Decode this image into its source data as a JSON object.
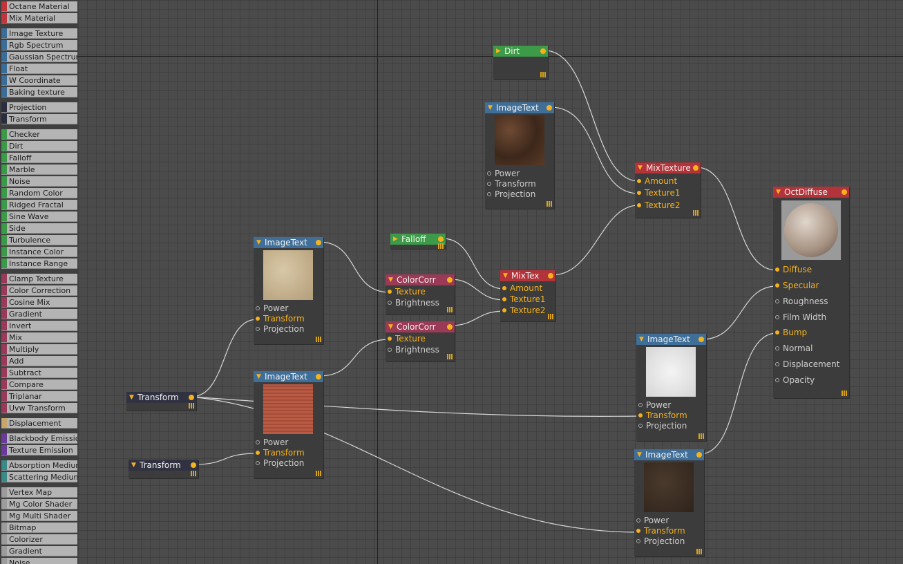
{
  "sidebar": {
    "items": [
      {
        "label": "Octane Material",
        "color": "#c0353c"
      },
      {
        "label": "Mix Material",
        "color": "#c0353c"
      },
      {
        "label": "Image Texture",
        "color": "#3b6d9b"
      },
      {
        "label": "Rgb Spectrum",
        "color": "#3b6d9b"
      },
      {
        "label": "Gaussian Spectrum",
        "color": "#3b6d9b"
      },
      {
        "label": "Float",
        "color": "#3b6d9b"
      },
      {
        "label": "W Coordinate",
        "color": "#3b6d9b"
      },
      {
        "label": "Baking texture",
        "color": "#3b6d9b"
      },
      {
        "label": "Projection",
        "color": "#2a2d3e"
      },
      {
        "label": "Transform",
        "color": "#2a2d3e"
      },
      {
        "label": "Checker",
        "color": "#3a9a48"
      },
      {
        "label": "Dirt",
        "color": "#3a9a48"
      },
      {
        "label": "Falloff",
        "color": "#3a9a48"
      },
      {
        "label": "Marble",
        "color": "#3a9a48"
      },
      {
        "label": "Noise",
        "color": "#3a9a48"
      },
      {
        "label": "Random Color",
        "color": "#3a9a48"
      },
      {
        "label": "Ridged Fractal",
        "color": "#3a9a48"
      },
      {
        "label": "Sine Wave",
        "color": "#3a9a48"
      },
      {
        "label": "Side",
        "color": "#3a9a48"
      },
      {
        "label": "Turbulence",
        "color": "#3a9a48"
      },
      {
        "label": "Instance Color",
        "color": "#3a9a48"
      },
      {
        "label": "Instance Range",
        "color": "#3a9a48"
      },
      {
        "label": "Clamp Texture",
        "color": "#9a3a5a"
      },
      {
        "label": "Color Correction",
        "color": "#9a3a5a"
      },
      {
        "label": "Cosine Mix",
        "color": "#9a3a5a"
      },
      {
        "label": "Gradient",
        "color": "#9a3a5a"
      },
      {
        "label": "Invert",
        "color": "#9a3a5a"
      },
      {
        "label": "Mix",
        "color": "#9a3a5a"
      },
      {
        "label": "Multiply",
        "color": "#9a3a5a"
      },
      {
        "label": "Add",
        "color": "#9a3a5a"
      },
      {
        "label": "Subtract",
        "color": "#9a3a5a"
      },
      {
        "label": "Compare",
        "color": "#9a3a5a"
      },
      {
        "label": "Triplanar",
        "color": "#9a3a5a"
      },
      {
        "label": "Uvw Transform",
        "color": "#9a3a5a"
      },
      {
        "label": "Displacement",
        "color": "#c6a66a"
      },
      {
        "label": "Blackbody Emission",
        "color": "#6a3a9a"
      },
      {
        "label": "Texture Emission",
        "color": "#6a3a9a"
      },
      {
        "label": "Absorption Medium",
        "color": "#3a8a8a"
      },
      {
        "label": "Scattering Medium",
        "color": "#3a8a8a"
      },
      {
        "label": "Vertex Map",
        "color": "#9c9c9c"
      },
      {
        "label": "Mg Color Shader",
        "color": "#9c9c9c"
      },
      {
        "label": "Mg Multi Shader",
        "color": "#9c9c9c"
      },
      {
        "label": "Bitmap",
        "color": "#9c9c9c"
      },
      {
        "label": "Colorizer",
        "color": "#9c9c9c"
      },
      {
        "label": "Gradient",
        "color": "#9c9c9c"
      },
      {
        "label": "Noise",
        "color": "#9c9c9c"
      }
    ]
  },
  "nodes": {
    "dirt": {
      "title": "Dirt"
    },
    "img_top": {
      "title": "ImageText",
      "ports": [
        "Power",
        "Transform",
        "Projection"
      ]
    },
    "mixtexture": {
      "title": "MixTexture",
      "ports": [
        "Amount",
        "Texture1",
        "Texture2"
      ]
    },
    "octdiffuse": {
      "title": "OctDiffuse",
      "ports": [
        "Diffuse",
        "Specular",
        "Roughness",
        "Film Width",
        "Bump",
        "Normal",
        "Displacement",
        "Opacity"
      ]
    },
    "img_sand": {
      "title": "ImageText",
      "ports": [
        "Power",
        "Transform",
        "Projection"
      ]
    },
    "falloff": {
      "title": "Falloff"
    },
    "colorcorr1": {
      "title": "ColorCorr",
      "ports": [
        "Texture",
        "Brightness"
      ]
    },
    "colorcorr2": {
      "title": "ColorCorr",
      "ports": [
        "Texture",
        "Brightness"
      ]
    },
    "mixtex": {
      "title": "MixTex",
      "ports": [
        "Amount",
        "Texture1",
        "Texture2"
      ]
    },
    "img_red": {
      "title": "ImageText",
      "ports": [
        "Power",
        "Transform",
        "Projection"
      ]
    },
    "transform1": {
      "title": "Transform"
    },
    "transform2": {
      "title": "Transform"
    },
    "img_white": {
      "title": "ImageText",
      "ports": [
        "Power",
        "Transform",
        "Projection"
      ]
    },
    "img_dark": {
      "title": "ImageText",
      "ports": [
        "Power",
        "Transform",
        "Projection"
      ]
    }
  },
  "colors": {
    "port_active": "#f5b21c",
    "wire": "#d8d8d8",
    "header_image": "#3f6e98",
    "header_material": "#b2333a",
    "header_texture_op": "#9a3a56",
    "header_generator": "#3d9a48",
    "header_transform": "#303241"
  }
}
